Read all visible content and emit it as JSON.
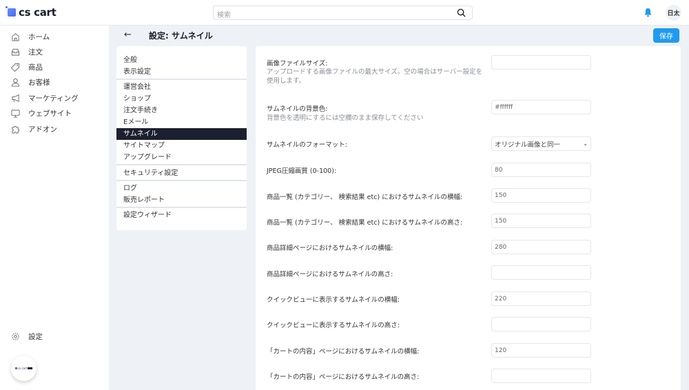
{
  "header": {
    "logo": "cs cart",
    "search_placeholder": "検索",
    "avatar": "日太"
  },
  "sidebar": {
    "items": [
      {
        "label": "ホーム",
        "icon": "home-icon"
      },
      {
        "label": "注文",
        "icon": "inbox-icon"
      },
      {
        "label": "商品",
        "icon": "tag-icon"
      },
      {
        "label": "お客様",
        "icon": "user-icon"
      },
      {
        "label": "マーケティング",
        "icon": "megaphone-icon"
      },
      {
        "label": "ウェブサイト",
        "icon": "monitor-icon"
      },
      {
        "label": "アドオン",
        "icon": "puzzle-icon"
      }
    ],
    "settings": "設定",
    "badge": "cs cart"
  },
  "page": {
    "title": "設定: サムネイル",
    "save": "保存"
  },
  "menu": {
    "items": [
      "全般",
      "表示設定",
      "運営会社",
      "ショップ",
      "注文手続き",
      "Eメール",
      "サムネイル",
      "サイトマップ",
      "アップグレード",
      "セキュリティ設定",
      "ログ",
      "販売レポート",
      "設定ウィザード"
    ],
    "active": "サムネイル"
  },
  "form": {
    "fields": [
      {
        "label": "画像ファイルサイズ:",
        "desc": "アップロードする画像ファイルの最大サイズ。空の場合はサーバー設定を使用します。",
        "value": ""
      },
      {
        "label": "サムネイルの背景色:",
        "desc": "背景色を透明にするには空欄のまま保存してください",
        "value": "#ffffff"
      },
      {
        "label": "サムネイルのフォーマット:",
        "value": "オリジナル画像と同一",
        "type": "select"
      },
      {
        "label": "JPEG圧縮画質 (0-100):",
        "value": "80"
      },
      {
        "label": "商品一覧 (カテゴリー、 検索結果 etc) におけるサムネイルの横幅:",
        "value": "150"
      },
      {
        "label": "商品一覧 (カテゴリー、 検索結果 etc) におけるサムネイルの高さ:",
        "value": "150"
      },
      {
        "label": "商品詳細ページにおけるサムネイルの横幅:",
        "value": "280"
      },
      {
        "label": "商品詳細ページにおけるサムネイルの高さ:",
        "value": ""
      },
      {
        "label": "クイックビューに表示するサムネイルの横幅:",
        "value": "220"
      },
      {
        "label": "クイックビューに表示するサムネイルの高さ:",
        "value": ""
      },
      {
        "label": "「カートの内容」ページにおけるサムネイルの横幅:",
        "value": "120"
      },
      {
        "label": "「カートの内容」ページにおけるサムネイルの高さ:",
        "value": ""
      }
    ]
  },
  "colors": {
    "accent": "#1e9bf0",
    "active_menu": "#1b1f2e",
    "background": "#eef2f7"
  }
}
